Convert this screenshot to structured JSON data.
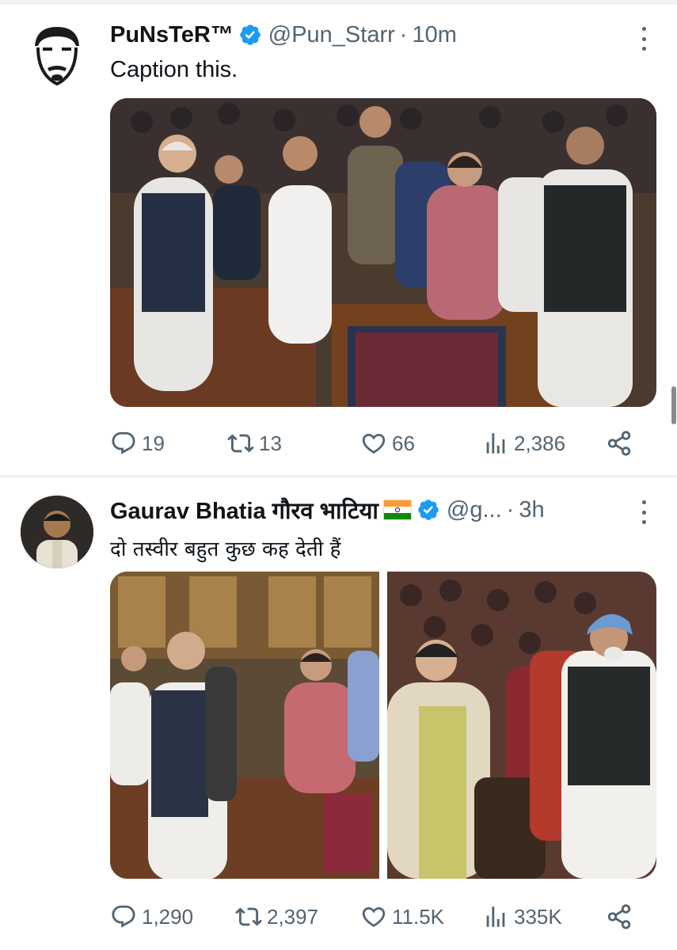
{
  "colors": {
    "text": "#0f1419",
    "secondary": "#536471",
    "verified": "#1d9bf0",
    "divider": "#eff3f4"
  },
  "tweets": [
    {
      "name": "PuNsTeR™",
      "handle": "@Pun_Starr",
      "separator": "·",
      "time": "10m",
      "text": "Caption this.",
      "actions": {
        "replies": "19",
        "reposts": "13",
        "likes": "66",
        "views": "2,386"
      },
      "icons": [
        "reply-icon",
        "repost-icon",
        "like-icon",
        "views-icon",
        "share-icon"
      ]
    },
    {
      "name": "Gaurav Bhatia गौरव भाटिया",
      "flag": "india-flag",
      "handle": "@g...",
      "separator": "·",
      "time": "3h",
      "text": "दो तस्वीर बहुत कुछ कह देती हैं",
      "actions": {
        "replies": "1,290",
        "reposts": "2,397",
        "likes": "11.5K",
        "views": "335K"
      },
      "icons": [
        "reply-icon",
        "repost-icon",
        "like-icon",
        "views-icon",
        "share-icon"
      ]
    }
  ]
}
